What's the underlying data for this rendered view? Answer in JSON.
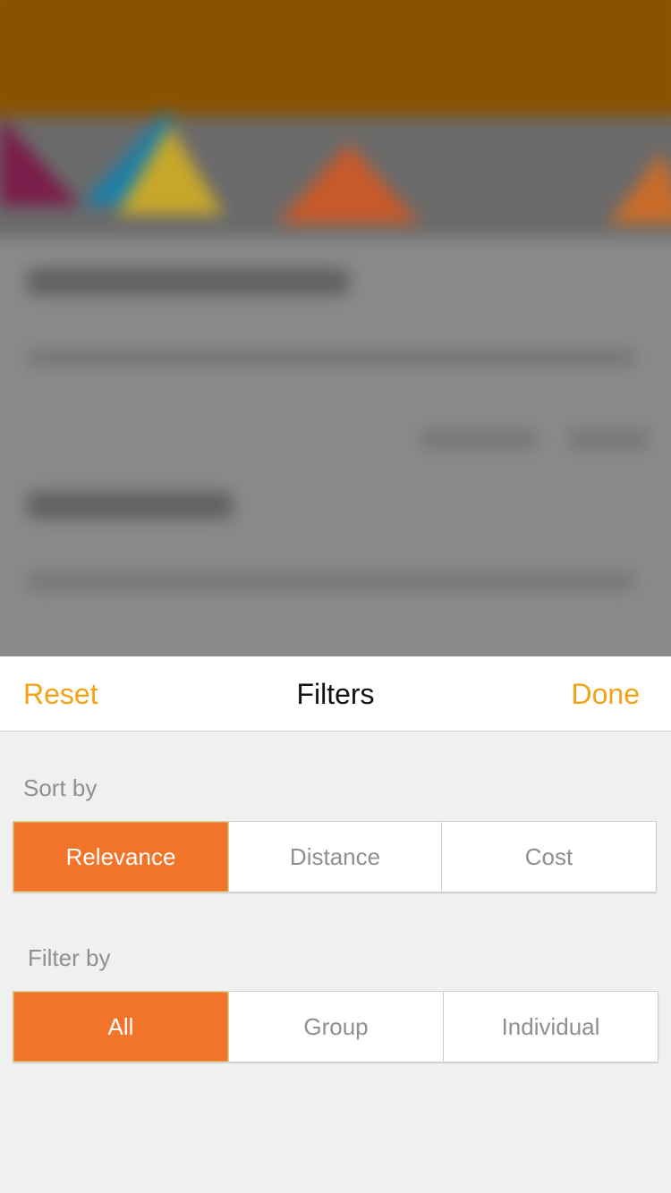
{
  "header": {
    "reset_label": "Reset",
    "title": "Filters",
    "done_label": "Done"
  },
  "sort": {
    "label": "Sort by",
    "options": [
      "Relevance",
      "Distance",
      "Cost"
    ],
    "selected": "Relevance"
  },
  "filter": {
    "label": "Filter by",
    "options": [
      "All",
      "Group",
      "Individual"
    ],
    "selected": "All"
  },
  "colors": {
    "accent": "#f4a316",
    "selected_segment": "#f2742b"
  }
}
